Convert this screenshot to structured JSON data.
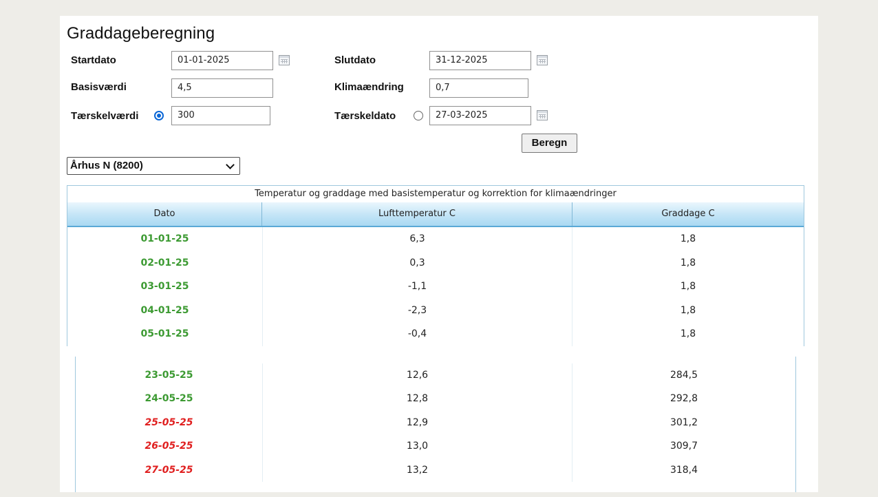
{
  "form": {
    "title": "Graddageberegning",
    "startdato_label": "Startdato",
    "startdato_value": "01-01-2025",
    "slutdato_label": "Slutdato",
    "slutdato_value": "31-12-2025",
    "basis_label": "Basisværdi",
    "basis_value": "4,5",
    "klima_label": "Klimaændring",
    "klima_value": "0,7",
    "taerskelvaerdi_label": "Tærskelværdi",
    "taerskelvaerdi_value": "300",
    "taerskelvaerdi_selected": true,
    "taerskeldato_label": "Tærskeldato",
    "taerskeldato_value": "27-03-2025",
    "taerskeldato_selected": false,
    "calc_button": "Beregn",
    "station_select": "Århus N (8200)"
  },
  "table": {
    "caption": "Temperatur og graddage med basistemperatur og korrektion for klimaændringer",
    "columns": [
      "Dato",
      "Lufttemperatur C",
      "Graddage C"
    ],
    "rows_top": [
      {
        "date": "01-01-25",
        "temp": "6,3",
        "gd": "1,8",
        "status": "green"
      },
      {
        "date": "02-01-25",
        "temp": "0,3",
        "gd": "1,8",
        "status": "green"
      },
      {
        "date": "03-01-25",
        "temp": "-1,1",
        "gd": "1,8",
        "status": "green"
      },
      {
        "date": "04-01-25",
        "temp": "-2,3",
        "gd": "1,8",
        "status": "green"
      },
      {
        "date": "05-01-25",
        "temp": "-0,4",
        "gd": "1,8",
        "status": "green"
      }
    ],
    "rows_bottom": [
      {
        "date": "23-05-25",
        "temp": "12,6",
        "gd": "284,5",
        "status": "green"
      },
      {
        "date": "24-05-25",
        "temp": "12,8",
        "gd": "292,8",
        "status": "green"
      },
      {
        "date": "25-05-25",
        "temp": "12,9",
        "gd": "301,2",
        "status": "red"
      },
      {
        "date": "26-05-25",
        "temp": "13,0",
        "gd": "309,7",
        "status": "red"
      },
      {
        "date": "27-05-25",
        "temp": "13,2",
        "gd": "318,4",
        "status": "red"
      }
    ]
  },
  "colors": {
    "below_threshold": "#3c9a32",
    "above_threshold": "#e01f1f",
    "header_accent": "#5aa9d6"
  }
}
